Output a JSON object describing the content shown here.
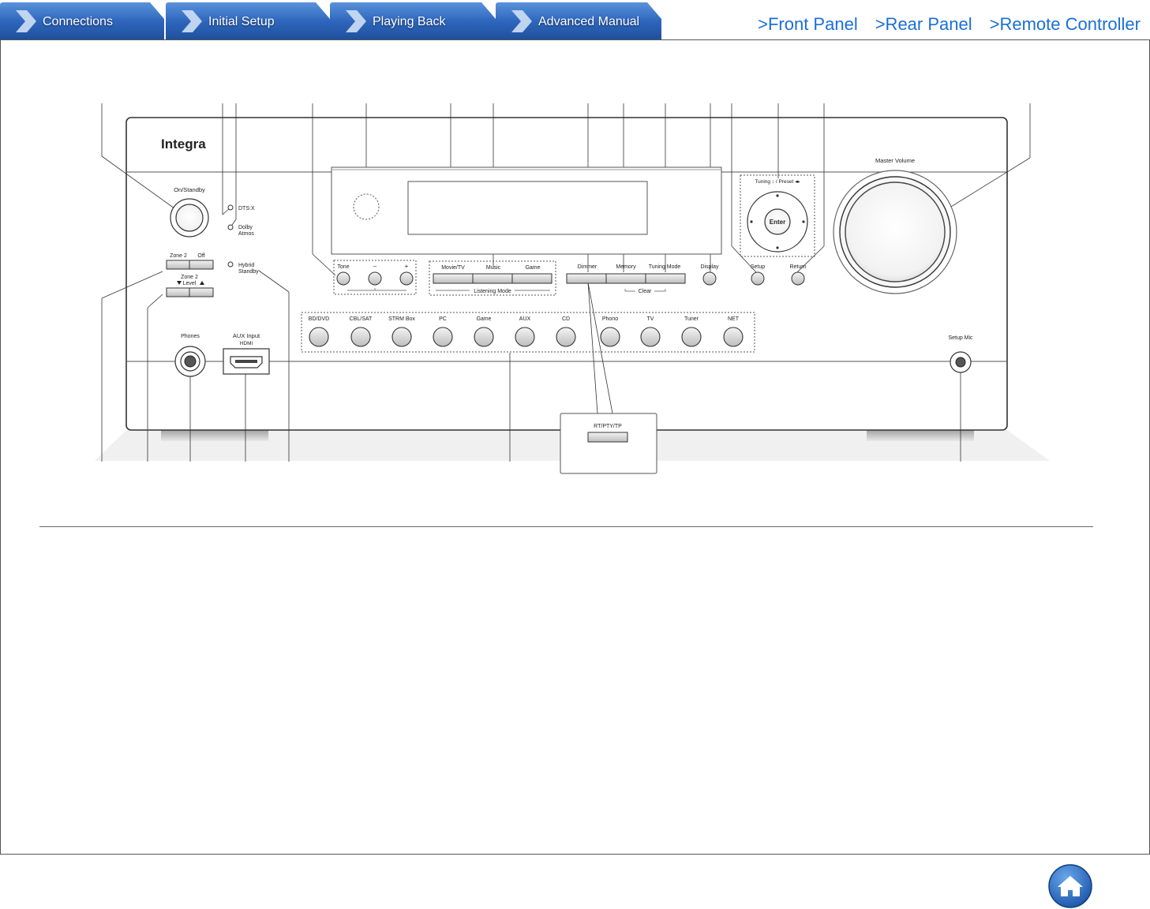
{
  "tabs": [
    {
      "label": "Connections"
    },
    {
      "label": "Initial Setup"
    },
    {
      "label": "Playing Back"
    },
    {
      "label": "Advanced Manual"
    }
  ],
  "top_links": [
    {
      "label": ">Front Panel"
    },
    {
      "label": ">Rear Panel"
    },
    {
      "label": ">Remote Controller"
    }
  ],
  "device": {
    "brand": "Integra",
    "on_standby": "On/Standby",
    "dtsx": "DTS:X",
    "dolby_1": "Dolby",
    "dolby_2": "Atmos",
    "zone2": "Zone 2",
    "off": "Off",
    "zone2_level_1": "Zone 2",
    "zone2_level_2": "Level",
    "hybrid_1": "Hybrid",
    "hybrid_2": "Standby",
    "tone": "Tone",
    "minus": "–",
    "plus": "+",
    "movie_tv": "Movie/TV",
    "music": "Music",
    "game_mode": "Game",
    "listening_mode": "Listening Mode",
    "dimmer": "Dimmer",
    "memory": "Memory",
    "tuning_mode": "Tuning Mode",
    "clear": "Clear",
    "display": "Display",
    "tuning_preset": "Tuning ↕ / Preset ◂▸",
    "enter": "Enter",
    "setup": "Setup",
    "return": "Return",
    "master_volume": "Master Volume",
    "phones": "Phones",
    "aux_input": "AUX Input",
    "hdmi": "HDMI",
    "setup_mic": "Setup Mic",
    "rt_pty_tp": "RT/PTY/TP",
    "selectors": [
      "BD/DVD",
      "CBL/SAT",
      "STRM Box",
      "PC",
      "Game",
      "AUX",
      "CD",
      "Phono",
      "TV",
      "Tuner",
      "NET"
    ]
  },
  "colors": {
    "tab_blue": "#2a5fb0",
    "link_blue": "#1a6fd6",
    "home_blue": "#1f63b8"
  },
  "home": {
    "icon": "home-icon"
  }
}
